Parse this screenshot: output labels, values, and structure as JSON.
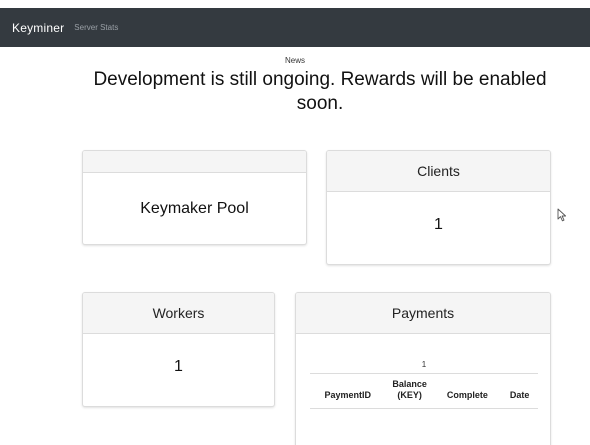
{
  "navbar": {
    "brand": "Keyminer",
    "links": [
      "Server Stats"
    ]
  },
  "news": {
    "label": "News",
    "headline": "Development is still ongoing. Rewards will be enabled soon."
  },
  "cards": {
    "pool": {
      "header": "",
      "value": "Keymaker Pool"
    },
    "clients": {
      "header": "Clients",
      "value": "1"
    },
    "workers": {
      "header": "Workers",
      "value": "1"
    },
    "payments": {
      "header": "Payments",
      "count": "1",
      "columns": [
        "PaymentID",
        "Balance (KEY)",
        "Complete",
        "Date"
      ]
    }
  },
  "colors": {
    "navbar_bg": "#343a40",
    "card_header_bg": "#f5f5f5"
  }
}
